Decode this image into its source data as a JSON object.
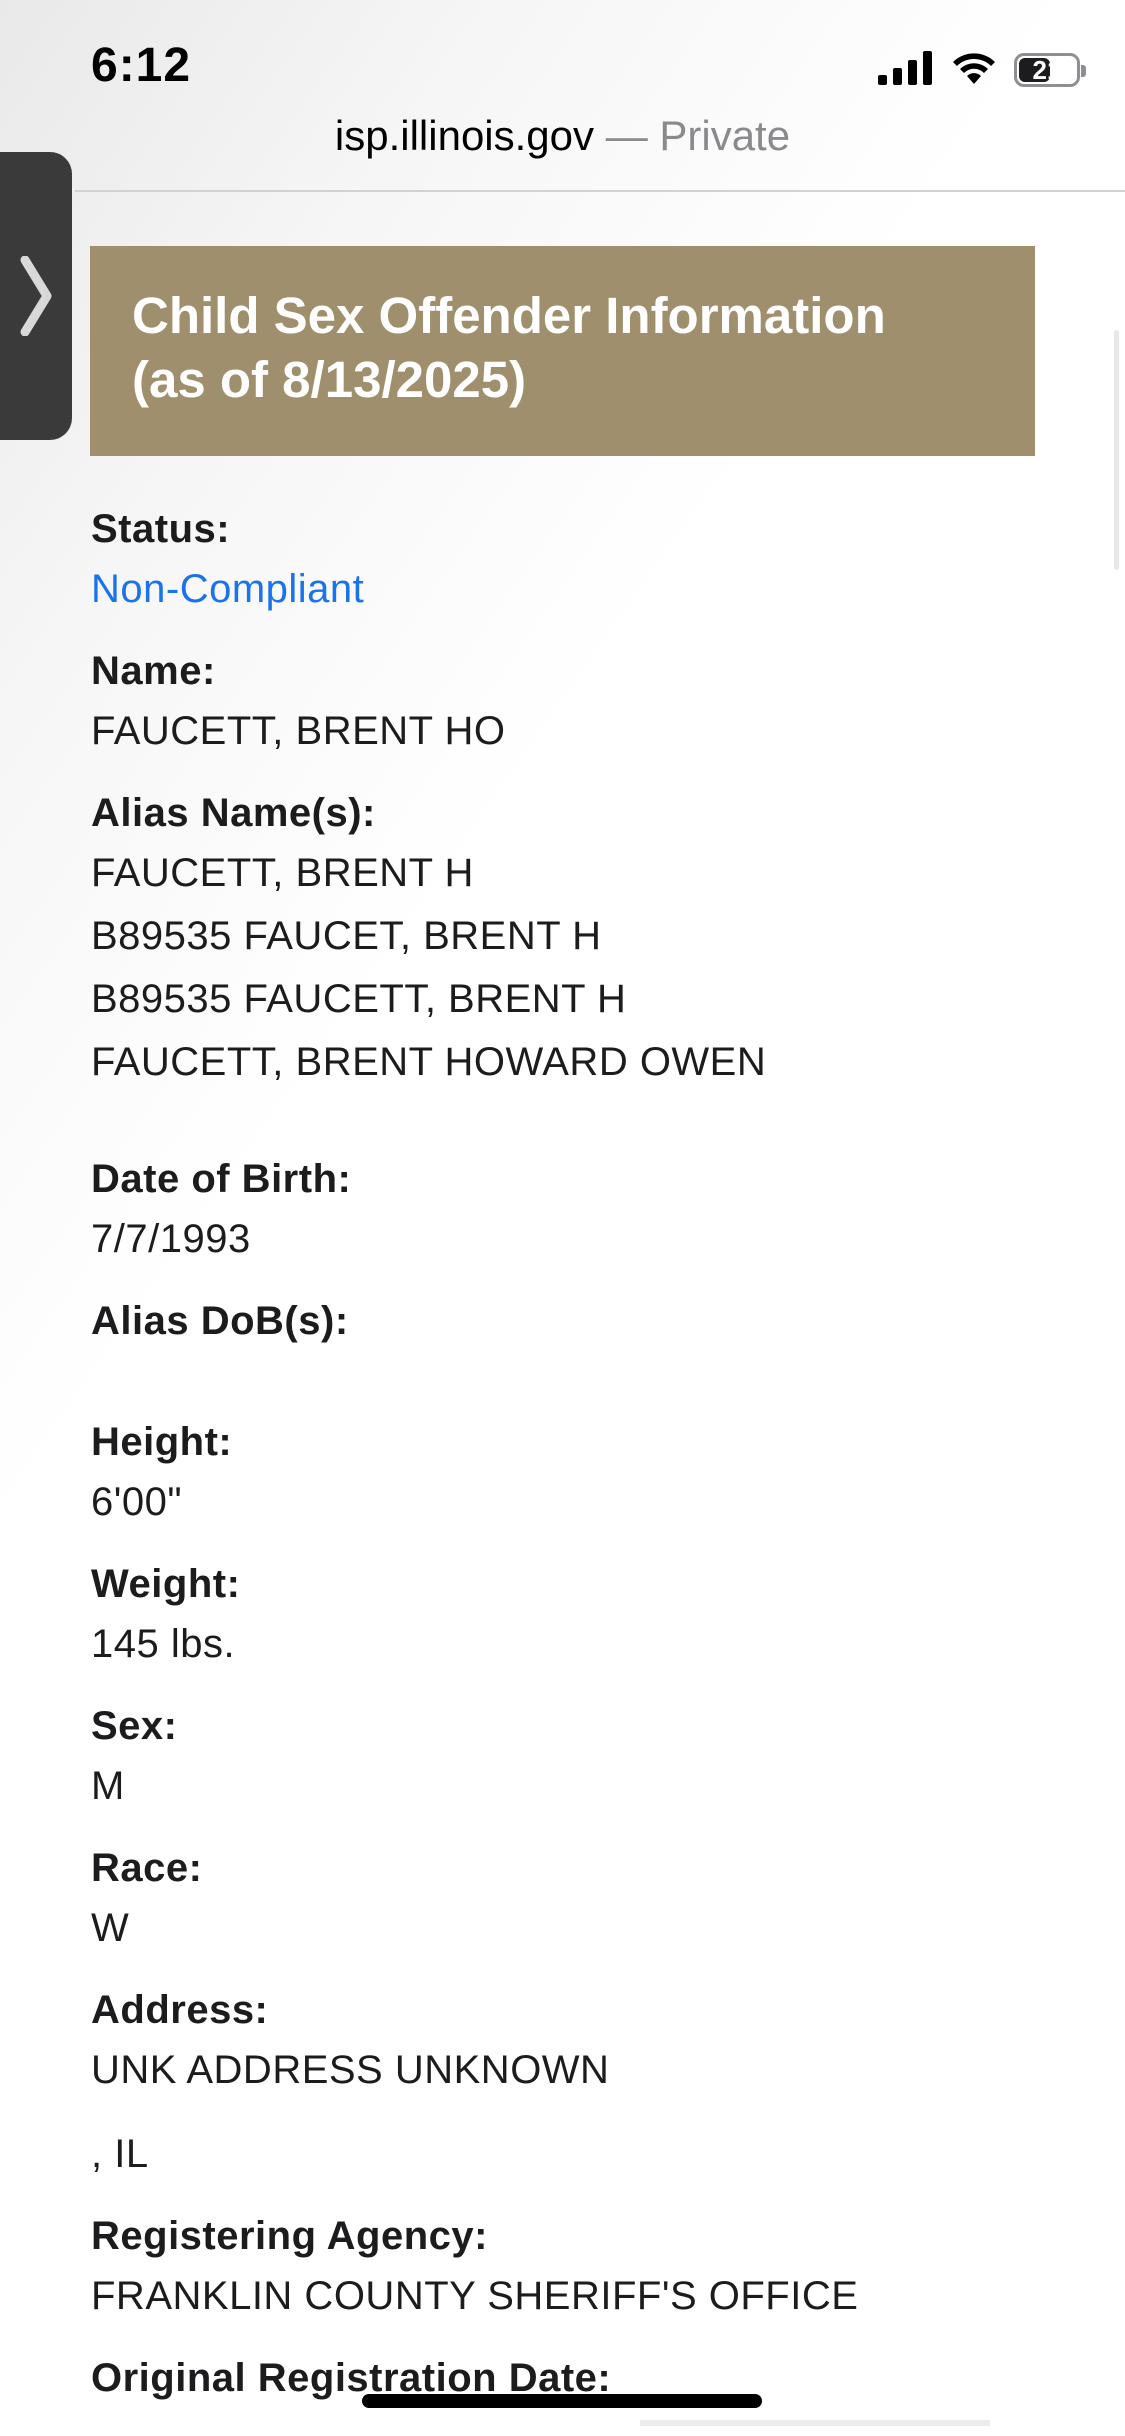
{
  "status_bar": {
    "time": "6:12",
    "battery": "21",
    "battery_level": 0.21
  },
  "browser": {
    "domain": "isp.illinois.gov",
    "mode": "— Private"
  },
  "banner": {
    "title_line1": "Child Sex Offender Information",
    "title_line2": "(as of 8/13/2025)",
    "color": "#a08f6d"
  },
  "fields": {
    "status_label": "Status:",
    "status_value": "Non-Compliant",
    "name_label": "Name:",
    "name_value": "FAUCETT, BRENT HO",
    "alias_label": "Alias Name(s):",
    "aliases": [
      "FAUCETT, BRENT H",
      "B89535 FAUCET, BRENT H",
      "B89535 FAUCETT, BRENT H",
      "FAUCETT, BRENT HOWARD OWEN"
    ],
    "dob_label": "Date of Birth:",
    "dob_value": "7/7/1993",
    "alias_dob_label": "Alias DoB(s):",
    "height_label": "Height:",
    "height_value": "6'00\"",
    "weight_label": "Weight:",
    "weight_value": "145 lbs.",
    "sex_label": "Sex:",
    "sex_value": "M",
    "race_label": "Race:",
    "race_value": "W",
    "address_label": "Address:",
    "address_line1": "UNK ADDRESS UNKNOWN",
    "address_line2": ", IL",
    "agency_label": "Registering Agency:",
    "agency_value": "FRANKLIN COUNTY SHERIFF'S OFFICE",
    "orig_reg_label": "Original Registration Date:"
  },
  "colors": {
    "link": "#1a73e8",
    "banner": "#a08f6d"
  },
  "icons": {
    "side_tab": "chevron-right-icon",
    "signal": "cellular-signal-icon",
    "wifi": "wifi-icon",
    "battery": "battery-icon"
  }
}
